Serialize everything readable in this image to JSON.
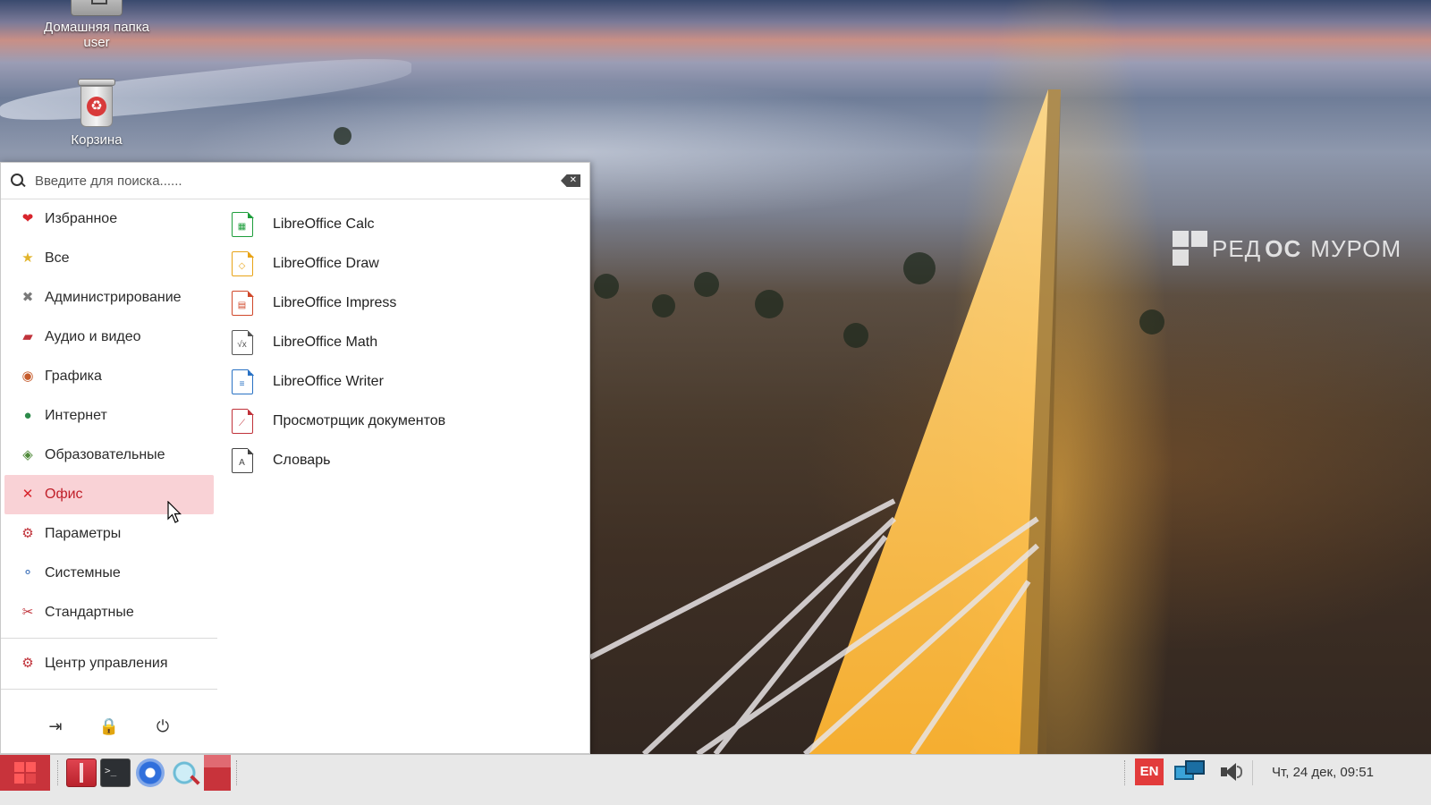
{
  "desktop": {
    "icons": [
      {
        "label": "Домашняя папка user",
        "icon": "home-folder-icon"
      },
      {
        "label": "Корзина",
        "icon": "trash-icon"
      }
    ],
    "wallpaper_brand": {
      "part1": "РЕД",
      "part2": "ОС",
      "part3": "МУРОМ"
    }
  },
  "menu": {
    "search": {
      "placeholder": "Введите для поиска......",
      "value": ""
    },
    "categories": [
      {
        "label": "Избранное",
        "icon": "heart-icon",
        "color": "#d8242c",
        "active": false
      },
      {
        "label": "Все",
        "icon": "star-icon",
        "color": "#e2b42b",
        "active": false
      },
      {
        "label": "Администрирование",
        "icon": "tools-icon",
        "color": "#7a7a7a",
        "active": false
      },
      {
        "label": "Аудио и видео",
        "icon": "clapper-icon",
        "color": "#c0323a",
        "active": false
      },
      {
        "label": "Графика",
        "icon": "palette-icon",
        "color": "#c55b2b",
        "active": false
      },
      {
        "label": "Интернет",
        "icon": "globe-icon",
        "color": "#2d8a4a",
        "active": false
      },
      {
        "label": "Образовательные",
        "icon": "education-icon",
        "color": "#4f8a3a",
        "active": false
      },
      {
        "label": "Офис",
        "icon": "office-icon",
        "color": "#d8242c",
        "active": true
      },
      {
        "label": "Параметры",
        "icon": "settings-icon",
        "color": "#c0323a",
        "active": false
      },
      {
        "label": "Системные",
        "icon": "system-icon",
        "color": "#3a6fb8",
        "active": false
      },
      {
        "label": "Стандартные",
        "icon": "scissors-icon",
        "color": "#c0323a",
        "active": false
      }
    ],
    "control_center": {
      "label": "Центр управления",
      "icon": "control-center-icon"
    },
    "actions": [
      {
        "name": "logout",
        "icon": "logout-icon",
        "glyph": "⇥"
      },
      {
        "name": "lock",
        "icon": "lock-icon",
        "glyph": "🔒"
      },
      {
        "name": "power",
        "icon": "power-icon",
        "glyph": "⏻"
      }
    ],
    "apps": [
      {
        "label": "LibreOffice Calc",
        "icon": "libreoffice-calc-icon",
        "color": "#1e9e3c",
        "mark": "▦"
      },
      {
        "label": "LibreOffice Draw",
        "icon": "libreoffice-draw-icon",
        "color": "#e8a317",
        "mark": "◇"
      },
      {
        "label": "LibreOffice Impress",
        "icon": "libreoffice-impress-icon",
        "color": "#d0482a",
        "mark": "▤"
      },
      {
        "label": "LibreOffice Math",
        "icon": "libreoffice-math-icon",
        "color": "#555555",
        "mark": "√x"
      },
      {
        "label": "LibreOffice Writer",
        "icon": "libreoffice-writer-icon",
        "color": "#2a72c4",
        "mark": "≡"
      },
      {
        "label": "Просмотрщик документов",
        "icon": "document-viewer-icon",
        "color": "#c0323a",
        "mark": "⟋"
      },
      {
        "label": "Словарь",
        "icon": "dictionary-icon",
        "color": "#444444",
        "mark": "A"
      }
    ]
  },
  "taskbar": {
    "language": "EN",
    "clock": "Чт, 24 дек, 09:51",
    "accent": "#c8333b"
  }
}
